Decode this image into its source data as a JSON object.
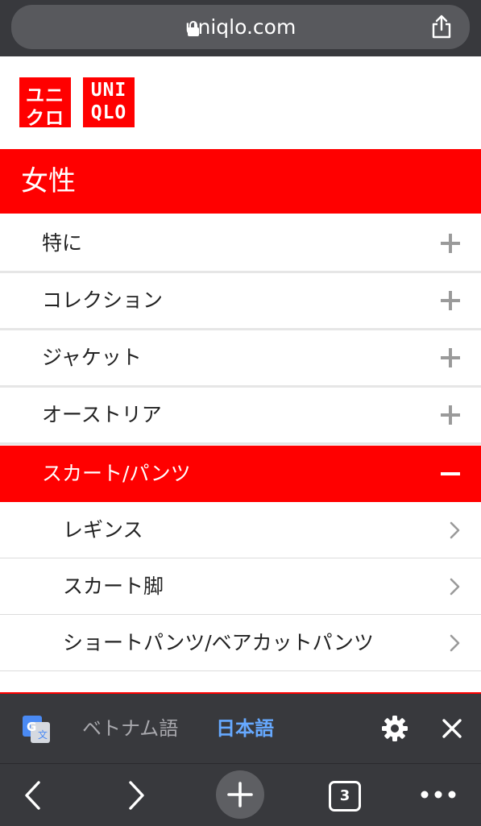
{
  "browser": {
    "url": "uniqlo.com",
    "lock_icon": "lock-icon",
    "share_icon": "share-icon"
  },
  "brand": {
    "logo_kana_line1": "ユニ",
    "logo_kana_line2": "クロ",
    "logo_latin_line1": "UNI",
    "logo_latin_line2": "QLO",
    "color": "#ff0000"
  },
  "section": {
    "title": "女性"
  },
  "categories": [
    {
      "label": "特に",
      "expanded": false
    },
    {
      "label": "コレクション",
      "expanded": false
    },
    {
      "label": "ジャケット",
      "expanded": false
    },
    {
      "label": "オーストリア",
      "expanded": false
    },
    {
      "label": "スカート/パンツ",
      "expanded": true
    }
  ],
  "subcategories": [
    {
      "label": "レギンス"
    },
    {
      "label": "スカート脚"
    },
    {
      "label": "ショートパンツ/ベアカットパンツ"
    }
  ],
  "translate_bar": {
    "source_language": "ベトナム語",
    "target_language": "日本語",
    "icons": [
      "google-translate-icon",
      "gear-icon",
      "close-icon"
    ]
  },
  "toolbar": {
    "tab_count": "3",
    "icons": [
      "back-icon",
      "forward-icon",
      "new-tab-icon",
      "tabs-icon",
      "more-icon"
    ]
  }
}
